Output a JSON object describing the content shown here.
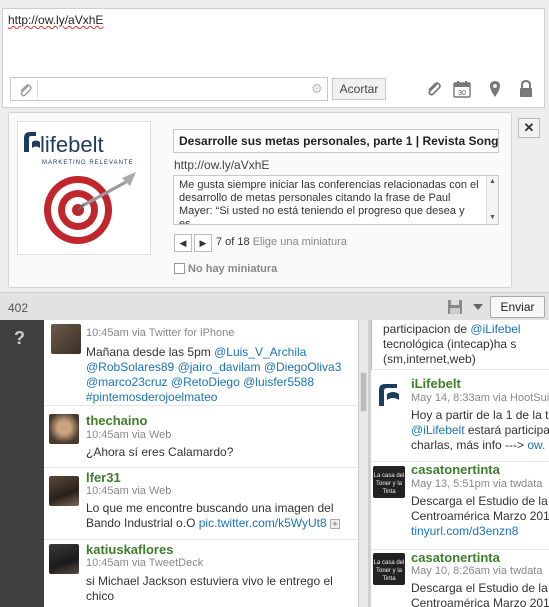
{
  "composer": {
    "message": "http://ow.ly/aVxhE",
    "url_placeholder": "",
    "shorten_label": "Acortar",
    "char_count": "402",
    "send_label": "Enviar",
    "close_label": "✕"
  },
  "preview": {
    "title": "Desarrolle sus metas personales, parte 1 | Revista Song",
    "url": "http://ow.ly/aVxhE",
    "description": "Me gusta siempre iniciar las conferencias relacionadas con el\ndesarrollo de metas personales citando la frase de Paul\nMayer: “Si usted no está teniendo el progreso que desea y es",
    "thumb_index": "7 of 18",
    "thumb_hint": "Elige una miniatura",
    "no_thumb_label": "No hay miniatura",
    "logo_text": "lifebelt",
    "logo_tagline": "MARKETING RELEVANTE"
  },
  "stream_left": {
    "help": "?",
    "tweets": [
      {
        "handle": "",
        "meta": "10:45am via Twitter for iPhone",
        "lines": [
          [
            "Mañana desde las 5pm ",
            "@Luis_V_Archila"
          ],
          [
            "@RobSolares89",
            " ",
            "@jairo_davilam",
            " ",
            "@DiegoOliva3"
          ],
          [
            "@marco23cruz",
            " ",
            "@RetoDiego",
            " ",
            "@luisfer5588"
          ],
          [
            "#pintemosderojoelmateo"
          ]
        ]
      },
      {
        "handle": "thechaino",
        "meta": "10:45am via Web",
        "text": "¿Ahora sí eres Calamardo?"
      },
      {
        "handle": "lfer31",
        "meta": "10:45am via Web",
        "text1": "Lo que me encontre buscando una imagen del",
        "text2a": "Bando Industrial o.O ",
        "text2b": "pic.twitter.com/k5WyUt8"
      },
      {
        "handle": "katiuskaflores",
        "meta": "10:45am via TweetDeck",
        "text1": "si Michael Jackson estuviera vivo le entrego el",
        "text2": "chico"
      }
    ]
  },
  "stream_right": {
    "top": {
      "line1a": "participacion de ",
      "line1b": "@iLifebel",
      "line2": "tecnológica (intecap)ha s",
      "line3": "(sm,internet,web)"
    },
    "tweets": [
      {
        "handle": "iLifebelt",
        "meta": "May 14, 8:33am via HootSuite",
        "l1": "Hoy a partir de la 1 de la t",
        "l2a": "@iLifebelt",
        "l2b": " estará participa",
        "l3a": "charlas, más info ---> ",
        "l3b": "ow."
      },
      {
        "handle": "casatonertinta",
        "meta": "May 13, 5:51pm via twdata",
        "l1": "Descarga el Estudio de la",
        "l2": "Centroamérica Marzo 201",
        "l3": "tinyurl.com/d3enzn8"
      },
      {
        "handle": "casatonertinta",
        "meta": "May 10, 8:26am via twdata",
        "l1": "Descarga el Estudio de la",
        "l2": "Centroamérica Marzo 201"
      }
    ]
  },
  "colors": {
    "handle": "#3e7d2b",
    "link": "#1a73b8",
    "sidebar": "#3f3f3f",
    "logo_red": "#c0272d"
  }
}
